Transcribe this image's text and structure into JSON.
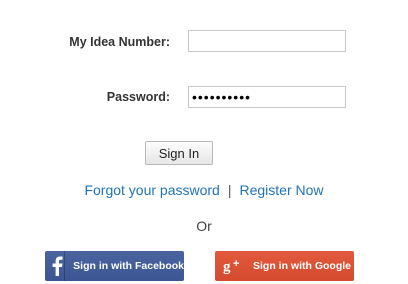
{
  "form": {
    "idea_number_label": "My Idea Number:",
    "idea_number_value": "",
    "password_label": "Password:",
    "password_value": "••••••••••",
    "sign_in_label": "Sign In"
  },
  "links": {
    "forgot_password": "Forgot your password",
    "separator": "|",
    "register": "Register Now"
  },
  "or_text": "Or",
  "social": {
    "facebook_label": "Sign in with Facebook",
    "facebook_icon": "facebook-icon",
    "facebook_color": "#3b5998",
    "google_label": "Sign in with Google",
    "google_icon": "google-plus-icon",
    "google_color": "#dd4b39"
  },
  "colors": {
    "link": "#1f73b7",
    "label": "#333333"
  }
}
